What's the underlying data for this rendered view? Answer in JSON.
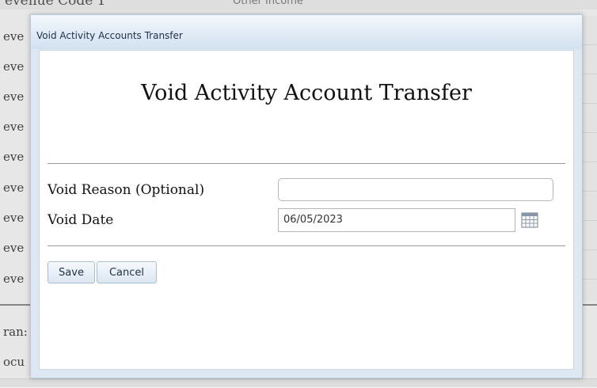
{
  "background": {
    "top_label": "evenue Code 1",
    "top_value": "Other Income",
    "row_labels": [
      "eve",
      "eve",
      "eve",
      "eve",
      "eve",
      "eve",
      "eve",
      "eve",
      "eve"
    ],
    "lower_labels": [
      "ran:",
      "ocu"
    ]
  },
  "dialog": {
    "title": "Void Activity Accounts Transfer",
    "heading": "Void Activity Account Transfer",
    "fields": {
      "void_reason": {
        "label": "Void Reason (Optional)",
        "value": "",
        "placeholder": ""
      },
      "void_date": {
        "label": "Void Date",
        "value": "06/05/2023",
        "icon": "calendar-icon"
      }
    },
    "buttons": {
      "save": "Save",
      "cancel": "Cancel"
    }
  }
}
